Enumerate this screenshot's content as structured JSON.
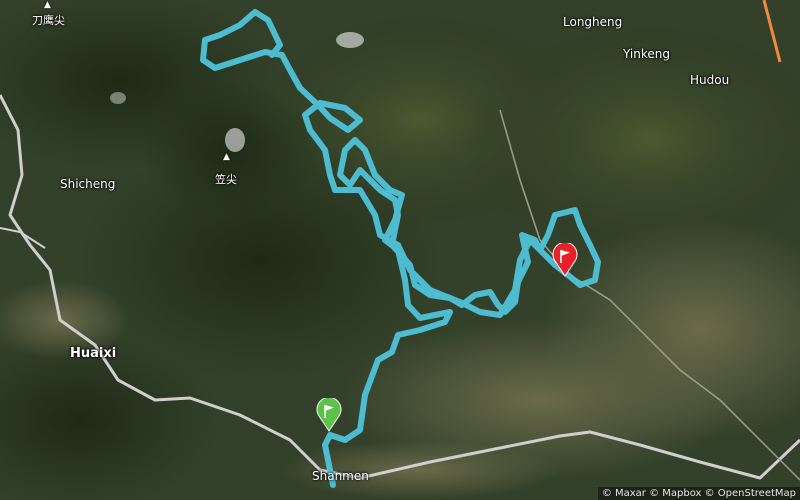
{
  "map": {
    "places": {
      "daoyingjian": "刀鹰尖",
      "longheng": "Longheng",
      "yinkeng": "Yinkeng",
      "hudou": "Hudou",
      "lijian": "笠尖",
      "shicheng": "Shicheng",
      "huaixi": "Huaixi",
      "shanmen": "Shanmen"
    },
    "attribution": "© Maxar © Mapbox © OpenStreetMap",
    "route_color": "#4fc3d9",
    "start_marker_color": "#5cc24a",
    "end_marker_color": "#e8202a",
    "road_color": "#d9d9d9",
    "highway_color": "#f08a3c"
  }
}
